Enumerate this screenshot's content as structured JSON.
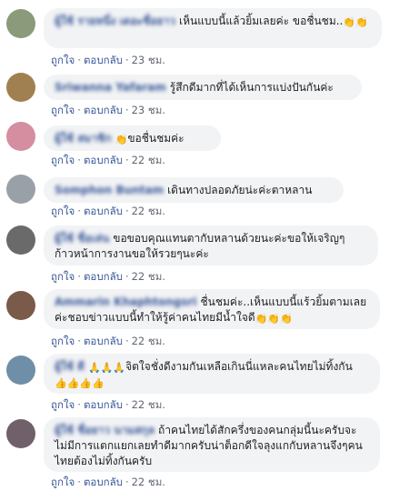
{
  "comments": [
    {
      "name": "ผู้ใช้ รายหนึ่ง เดอะชื่อยาว",
      "text": "เห็นแบบนี้แล้วยิ้มเลยค่ะ ขอชื่นชม..",
      "emoji": "👏👏",
      "like": "ถูกใจ",
      "reply": "ตอบกลับ",
      "time": "23 ชม.",
      "avatar_color": "#8a9a7a"
    },
    {
      "name": "Sriwanna Yafaram",
      "text": "รู้สึกดีมากที่ได้เห็นการแบ่งปันกันค่ะ",
      "emoji": "",
      "like": "ถูกใจ",
      "reply": "ตอบกลับ",
      "time": "23 ชม.",
      "avatar_color": "#a08050"
    },
    {
      "name": "ผู้ใช้ สมาชิก",
      "text": "ขอชื่นชมค่ะ",
      "emoji": "👏",
      "like": "ถูกใจ",
      "reply": "ตอบกลับ",
      "time": "22 ชม.",
      "avatar_color": "#d48ea0"
    },
    {
      "name": "Somphon Buntam",
      "text": "เดินทางปลอดภัยน่ะค่ะตาหลาน",
      "emoji": "",
      "like": "ถูกใจ",
      "reply": "ตอบกลับ",
      "time": "22 ชม.",
      "avatar_color": "#9aa0a8"
    },
    {
      "name": "ผู้ใช้ ชื่อเล่น",
      "text": "ขอขอบคุณแทนตากับหลานด้วยนะค่ะขอให้เจริญๆก้าวหน้าการงานขอให้รวยๆนะค่ะ",
      "emoji": "",
      "like": "ถูกใจ",
      "reply": "ตอบกลับ",
      "time": "22 ชม.",
      "avatar_color": "#6a6a6a"
    },
    {
      "name": "Ammarin Khaphtongsri",
      "text": "ชื่นชมค่ะ..เห็นแบบนี้แร้วยิ้มตามเลยค่ะชอบข่าวแบบนี้ทำให้รู้ค่าคนไทยมีน้ำใจดี",
      "emoji": "👏👏👏",
      "like": "ถูกใจ",
      "reply": "ตอบกลับ",
      "time": "22 ชม.",
      "avatar_color": "#7a5a48"
    },
    {
      "name": "ผู้ใช้ ดี",
      "text": "จิตใจชั่งดีงามกันเหลือเกินนี่แหละคนไทยไม่ทิ้งกัน",
      "emoji_before": "🙏🙏🙏",
      "emoji": "👍👍👍👍",
      "like": "ถูกใจ",
      "reply": "ตอบกลับ",
      "time": "22 ชม.",
      "avatar_color": "#6f8ea8"
    },
    {
      "name": "ผู้ใช้ ชื่อยาว นามสกุล",
      "text": "ถ้าคนไทยได้สักครึ่งของคนกลุ่มนี้นะครับจะไม่มีการแตกแยกเลยทำดีมากครับน่าต็อกดีใจลุงแกกับหลานจึงๆคนไทยต้องไม่ทิ้งกันครับ",
      "emoji": "",
      "like": "ถูกใจ",
      "reply": "ตอบกลับ",
      "time": "22 ชม.",
      "avatar_color": "#70606a"
    }
  ]
}
